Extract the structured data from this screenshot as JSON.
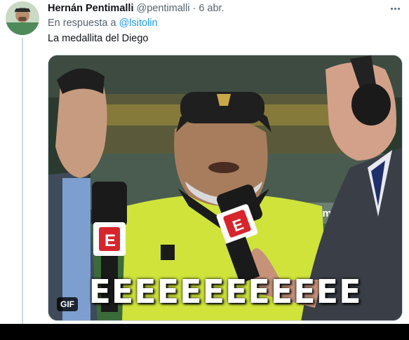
{
  "tweet": {
    "author_name": "Hernán Pentimalli",
    "author_handle": "@pentimalli",
    "separator": "·",
    "timestamp": "6 abr.",
    "reply_prefix": "En respuesta a",
    "reply_mention": "@lsitolin",
    "text": "La medallita del Diego",
    "more_icon": "more-horizontal-icon"
  },
  "media": {
    "type": "gif",
    "badge": "GIF",
    "caption": "EEEEEEEEEEEE",
    "banner_text": "e.mx",
    "mic_logo": "E"
  },
  "colors": {
    "link": "#1d9bf0",
    "secondary_text": "#536471",
    "primary_text": "#0f1419",
    "thread_line": "#cfd9de"
  }
}
